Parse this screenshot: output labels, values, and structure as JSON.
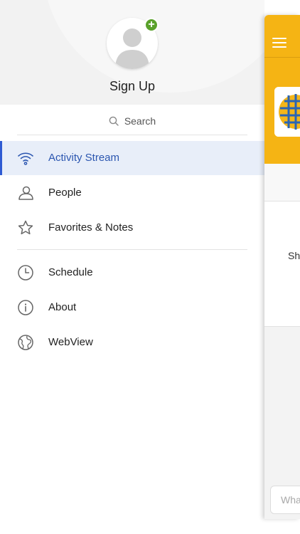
{
  "profile": {
    "signup_label": "Sign Up",
    "add_badge": "+"
  },
  "search": {
    "label": "Search"
  },
  "menu": {
    "items": [
      {
        "label": "Activity Stream",
        "icon": "wifi-icon",
        "active": true
      },
      {
        "label": "People",
        "icon": "person-icon"
      },
      {
        "label": "Favorites & Notes",
        "icon": "star-icon"
      },
      {
        "label": "Schedule",
        "icon": "clock-icon"
      },
      {
        "label": "About",
        "icon": "info-icon"
      },
      {
        "label": "WebView",
        "icon": "globe-icon"
      }
    ]
  },
  "panel": {
    "card_text": "Sh",
    "input_placeholder": "Wha"
  },
  "colors": {
    "accent": "#f5b414",
    "active_text": "#2b56b0",
    "active_bg": "#e8eef9",
    "badge_green": "#5aa12b"
  }
}
